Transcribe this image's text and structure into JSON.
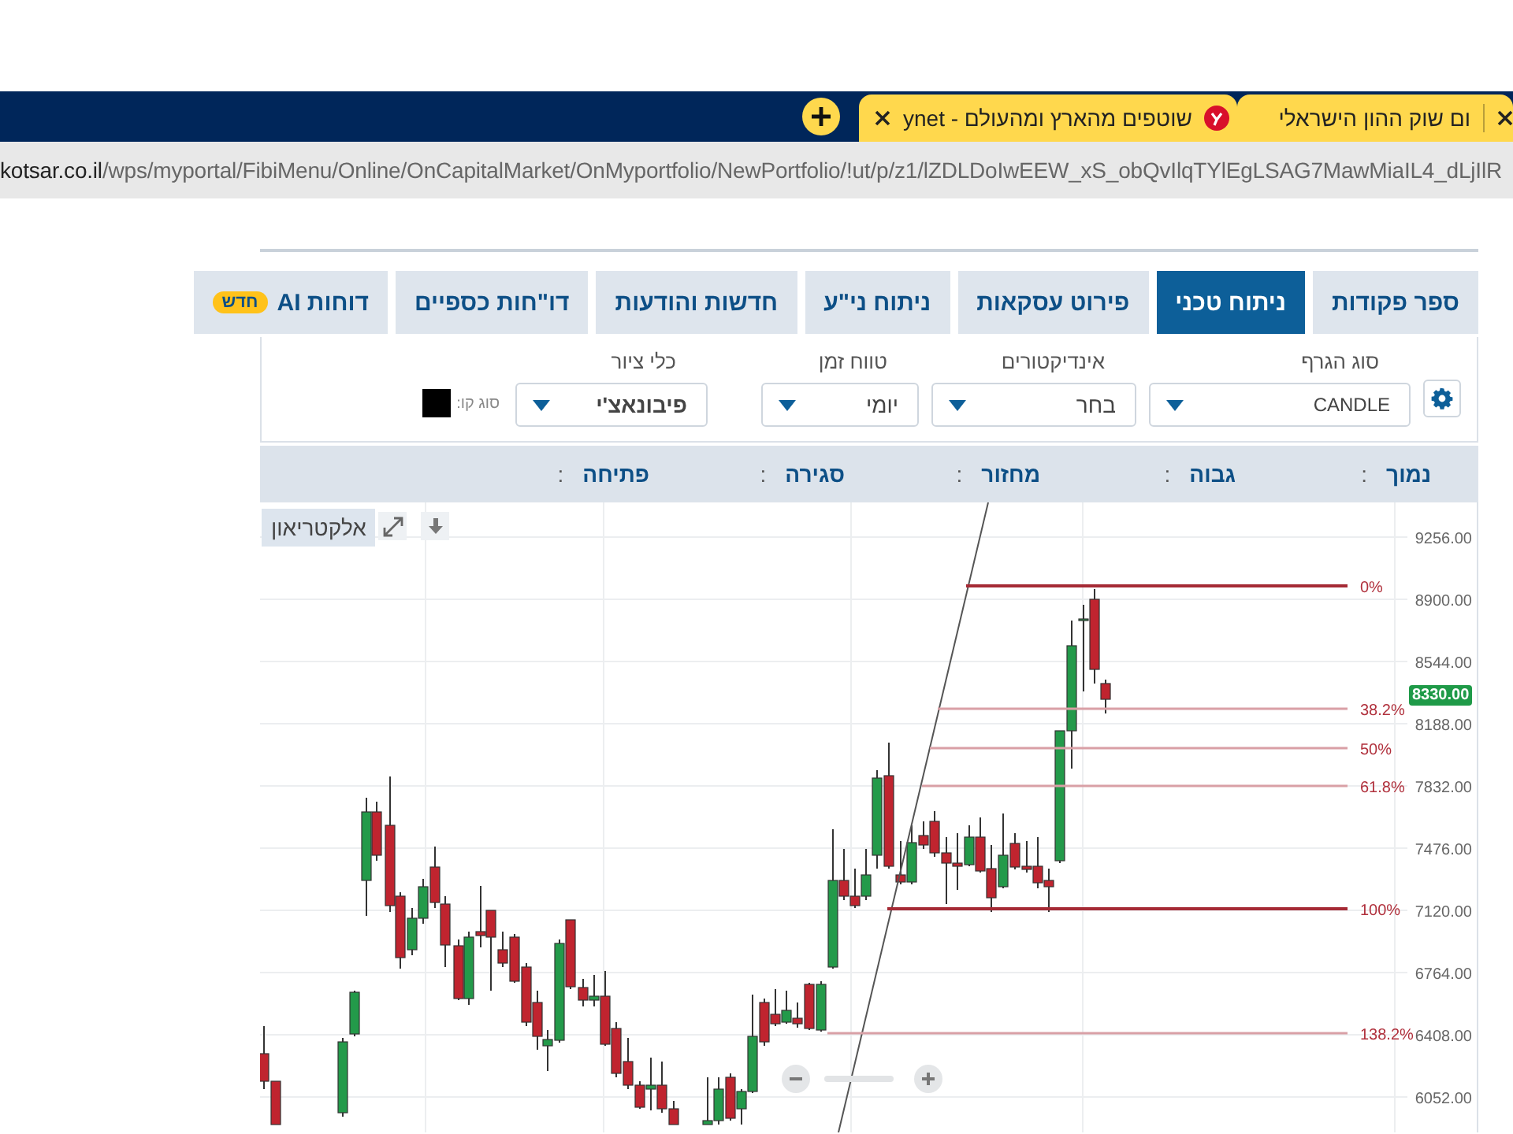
{
  "browser": {
    "tabs": [
      {
        "title": "ום שוק ההון הישראלי"
      },
      {
        "title": "ynet - שוטפים מהארץ ומהעולם"
      }
    ],
    "address": {
      "domain": "kotsar.co.il",
      "path": "/wps/myportal/FibiMenu/Online/OnCapitalMarket/OnMyportfolio/NewPortfolio/!ut/p/z1/lZDLDoIwEEW_xS_obQvIlqTYlEgLSAG7MawMiaIL4_dLjIlR"
    }
  },
  "tabs": [
    {
      "label": "ספר פקודות",
      "selected": false
    },
    {
      "label": "ניתוח טכני",
      "selected": true
    },
    {
      "label": "פירוט עסקאות",
      "selected": false
    },
    {
      "label": "ניתוח ני\"ע",
      "selected": false
    },
    {
      "label": "חדשות והודעות",
      "selected": false
    },
    {
      "label": "דו\"חות כספיים",
      "selected": false
    },
    {
      "label": "דוחות AI",
      "selected": false,
      "badge": "חדש"
    }
  ],
  "toolbar": {
    "fields": [
      {
        "label": "סוג הגרף",
        "value": "CANDLE",
        "kind": "latin"
      },
      {
        "label": "אינדיקטורים",
        "value": "בחר",
        "kind": "plain"
      },
      {
        "label": "טווח זמן",
        "value": "יומי",
        "kind": "plain"
      },
      {
        "label": "כלי ציור",
        "value": "פיבונאצ'י",
        "kind": "bold"
      }
    ],
    "line_type": {
      "label": "סוג קו:",
      "color": "#000000"
    }
  },
  "info": [
    {
      "label": "נמוך",
      "value": ":"
    },
    {
      "label": "גבוה",
      "value": ":"
    },
    {
      "label": "מחזור",
      "value": ":"
    },
    {
      "label": "סגירה",
      "value": ":"
    },
    {
      "label": "פתיחה",
      "value": ":"
    }
  ],
  "chart": {
    "instrument": "אלקטריאון",
    "yticks": [
      "9256.00",
      "8900.00",
      "8544.00",
      "8188.00",
      "7832.00",
      "7476.00",
      "7120.00",
      "6764.00",
      "6408.00",
      "6052.00"
    ],
    "last_price": "8330.00",
    "fib_levels": [
      "0%",
      "38.2%",
      "50%",
      "61.8%",
      "100%",
      "138.2%"
    ]
  }
}
